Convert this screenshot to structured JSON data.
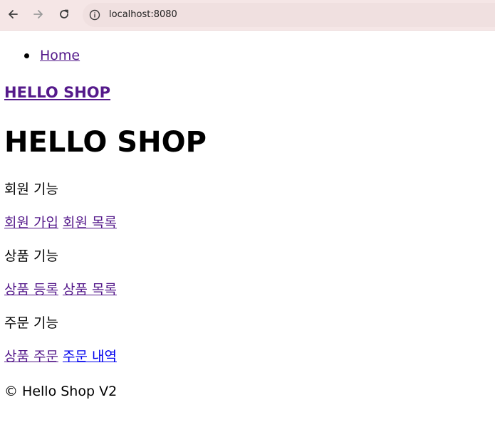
{
  "browser": {
    "url": "localhost:8080"
  },
  "nav": {
    "items": [
      {
        "label": "Home"
      }
    ]
  },
  "brand": "HELLO SHOP",
  "page_title": "HELLO SHOP",
  "sections": [
    {
      "heading": "회원 기능",
      "links": [
        {
          "label": "회원 가입"
        },
        {
          "label": "회원 목록"
        }
      ]
    },
    {
      "heading": "상품 기능",
      "links": [
        {
          "label": "상품 등록"
        },
        {
          "label": "상품 목록"
        }
      ]
    },
    {
      "heading": "주문 기능",
      "links": [
        {
          "label": "상품 주문"
        },
        {
          "label": "주문 내역"
        }
      ]
    }
  ],
  "footer": "© Hello Shop V2",
  "colors": {
    "visited_link": "#551a8b",
    "unvisited_link": "#0000ee",
    "browser_bar": "#f5e6e6"
  }
}
